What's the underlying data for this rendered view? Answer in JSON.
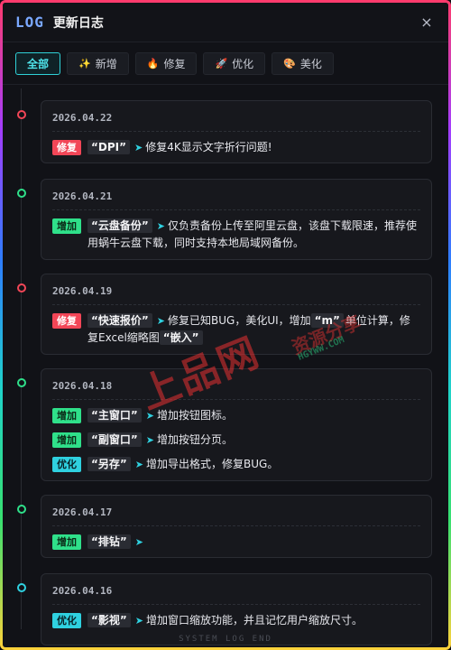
{
  "header": {
    "logo": "LOG",
    "title": "更新日志",
    "close": "×"
  },
  "tabs": [
    {
      "label": "全部",
      "icon": ""
    },
    {
      "label": "新增",
      "icon": "✨"
    },
    {
      "label": "修复",
      "icon": "🔥"
    },
    {
      "label": "优化",
      "icon": "🚀"
    },
    {
      "label": "美化",
      "icon": "🎨"
    }
  ],
  "entries": [
    {
      "date": "2026.04.22",
      "dot_color": "#f24657",
      "items": [
        {
          "badge": "修复",
          "type": "fix",
          "keyword": "“DPI”",
          "text": "修复4K显示文字折行问题!"
        }
      ]
    },
    {
      "date": "2026.04.21",
      "dot_color": "#2fe08a",
      "items": [
        {
          "badge": "增加",
          "type": "add",
          "keyword": "“云盘备份”",
          "text": "仅负责备份上传至阿里云盘，该盘下载限速，推荐使用蜗牛云盘下载，同时支持本地局域网备份。"
        }
      ]
    },
    {
      "date": "2026.04.19",
      "dot_color": "#f24657",
      "items": [
        {
          "badge": "修复",
          "type": "fix",
          "keyword": "“快速报价”",
          "text": "修复已知BUG，美化UI，增加",
          "keyword2": "“m”",
          "text2": "单位计算，修复Excel缩略图",
          "keyword3": "“嵌入”",
          "text3": ""
        }
      ]
    },
    {
      "date": "2026.04.18",
      "dot_color": "#2fe08a",
      "items": [
        {
          "badge": "增加",
          "type": "add",
          "keyword": "“主窗口”",
          "text": "增加按钮图标。"
        },
        {
          "badge": "增加",
          "type": "add",
          "keyword": "“副窗口”",
          "text": "增加按钮分页。"
        },
        {
          "badge": "优化",
          "type": "opt",
          "keyword": "“另存”",
          "text": "增加导出格式，修复BUG。"
        }
      ]
    },
    {
      "date": "2026.04.17",
      "dot_color": "#2fe08a",
      "items": [
        {
          "badge": "增加",
          "type": "add",
          "keyword": "“排钻”",
          "text": ""
        }
      ]
    },
    {
      "date": "2026.04.16",
      "dot_color": "#2fd1e0",
      "items": [
        {
          "badge": "优化",
          "type": "opt",
          "keyword": "“影视”",
          "text": "增加窗口缩放功能，并且记忆用户缩放尺寸。"
        }
      ]
    }
  ],
  "watermark": {
    "main": "上品网",
    "side": "资源分享",
    "url": "HGYWW.COM"
  },
  "footer": "SYSTEM LOG END"
}
